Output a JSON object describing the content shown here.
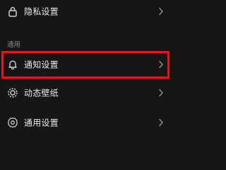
{
  "settings": {
    "items": [
      {
        "label": "隐私设置",
        "icon": "lock-icon"
      },
      {
        "label": "通知设置",
        "icon": "bell-icon"
      },
      {
        "label": "动态壁纸",
        "icon": "gear-sun-icon"
      },
      {
        "label": "通用设置",
        "icon": "gear-icon"
      }
    ],
    "section_general_label": "通用"
  },
  "colors": {
    "background": "#161616",
    "text": "#eaeaea",
    "section_text": "#8a8a8a",
    "icon": "#d0d0d0",
    "chevron": "#8f8f8f",
    "highlight_border": "#e2161b"
  }
}
